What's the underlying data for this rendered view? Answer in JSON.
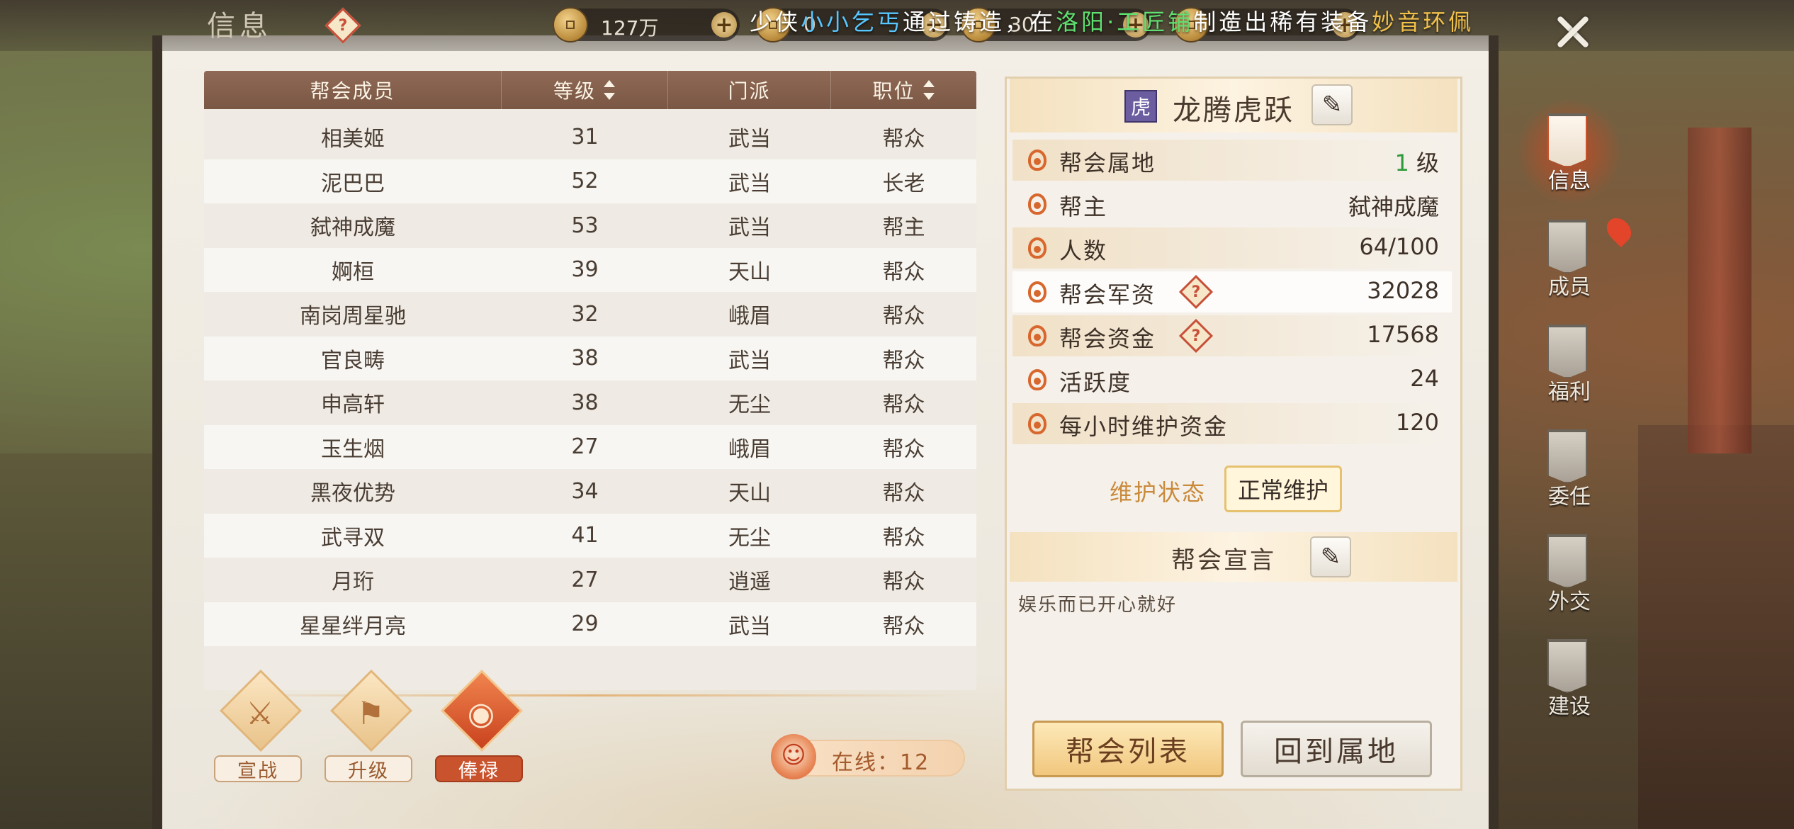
{
  "header": {
    "title": "信息",
    "help_icon": "question-diamond-icon",
    "currencies": [
      {
        "amount": "127万",
        "icon": "copper-coin-icon"
      },
      {
        "amount": "0",
        "icon": "gold-ingot-icon"
      },
      {
        "amount": "30",
        "icon": "silver-ingot-icon"
      },
      {
        "amount": "0",
        "icon": "gold-ingot-icon"
      }
    ],
    "marquee": {
      "part1": "少侠",
      "player": "小小乞丐",
      "part2": "通过铸造，在",
      "city": "洛阳",
      "sep": "·",
      "shop": "工匠铺",
      "part3": "制造出稀有装备",
      "item": "妙音环佩"
    },
    "close_icon": "close-x-icon"
  },
  "members": {
    "columns": [
      "帮会成员",
      "等级",
      "门派",
      "职位"
    ],
    "rows": [
      {
        "name": "相美姬",
        "level": "31",
        "sect": "武当",
        "rank": "帮众"
      },
      {
        "name": "泥巴巴",
        "level": "52",
        "sect": "武当",
        "rank": "长老"
      },
      {
        "name": "弑神成魔",
        "level": "53",
        "sect": "武当",
        "rank": "帮主"
      },
      {
        "name": "婀桓",
        "level": "39",
        "sect": "天山",
        "rank": "帮众"
      },
      {
        "name": "南岗周星驰",
        "level": "32",
        "sect": "峨眉",
        "rank": "帮众"
      },
      {
        "name": "官良畴",
        "level": "38",
        "sect": "武当",
        "rank": "帮众"
      },
      {
        "name": "申高轩",
        "level": "38",
        "sect": "无尘",
        "rank": "帮众"
      },
      {
        "name": "玉生烟",
        "level": "27",
        "sect": "峨眉",
        "rank": "帮众"
      },
      {
        "name": "黑夜优势",
        "level": "34",
        "sect": "天山",
        "rank": "帮众"
      },
      {
        "name": "武寻双",
        "level": "41",
        "sect": "无尘",
        "rank": "帮众"
      },
      {
        "name": "月珩",
        "level": "27",
        "sect": "逍遥",
        "rank": "帮众"
      },
      {
        "name": "星星绊月亮",
        "level": "29",
        "sect": "武当",
        "rank": "帮众"
      }
    ]
  },
  "actions": [
    {
      "label": "宣战",
      "icon": "crossed-swords-icon"
    },
    {
      "label": "升级",
      "icon": "banner-upgrade-icon"
    },
    {
      "label": "俸禄",
      "icon": "coin-salary-icon"
    }
  ],
  "online": {
    "label": "在线：",
    "count": "12"
  },
  "guild": {
    "emblem": "虎",
    "name": "龙腾虎跃",
    "stats": [
      {
        "label": "帮会属地",
        "value": "级",
        "level_num": "1"
      },
      {
        "label": "帮主",
        "value": "弑神成魔"
      },
      {
        "label": "人数",
        "value": "64/100"
      },
      {
        "label": "帮会军资",
        "value": "32028"
      },
      {
        "label": "帮会资金",
        "value": "17568"
      },
      {
        "label": "活跃度",
        "value": "24"
      },
      {
        "label": "每小时维护资金",
        "value": "120"
      }
    ],
    "maintenance_label": "维护状态",
    "maintenance_status": "正常维护",
    "declaration_title": "帮会宣言",
    "declaration_text": "娱乐而已开心就好",
    "list_button": "帮会列表",
    "home_button": "回到属地"
  },
  "sidebar": {
    "tabs": [
      "信息",
      "成员",
      "福利",
      "委任",
      "外交",
      "建设"
    ],
    "active_index": 0
  },
  "colors": {
    "accent_orange": "#c9532c",
    "table_header": "#7a5644",
    "level_green": "#2e9a3a",
    "marquee_cyan": "#57c7ff",
    "marquee_green": "#5fe070"
  }
}
